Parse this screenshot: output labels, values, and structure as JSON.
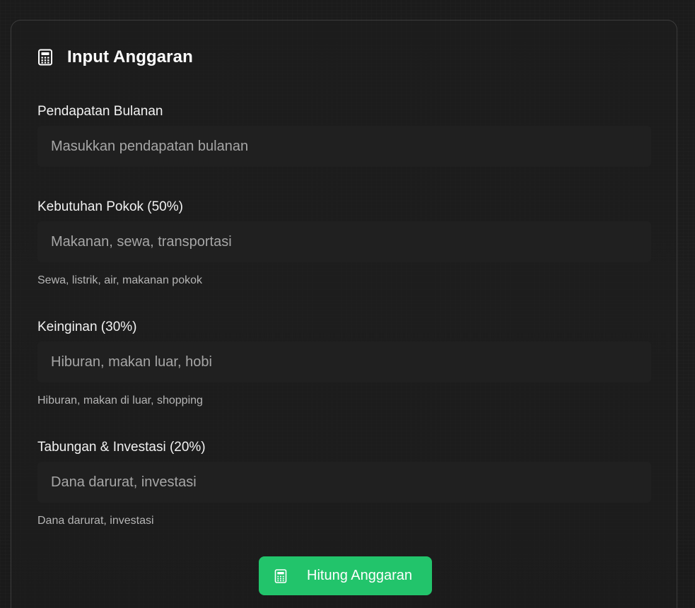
{
  "card": {
    "icon": "calculator-icon",
    "title": "Input Anggaran"
  },
  "fields": [
    {
      "label": "Pendapatan Bulanan",
      "placeholder": "Masukkan pendapatan bulanan",
      "value": "",
      "hint": ""
    },
    {
      "label": "Kebutuhan Pokok (50%)",
      "placeholder": "Makanan, sewa, transportasi",
      "value": "",
      "hint": "Sewa, listrik, air, makanan pokok"
    },
    {
      "label": "Keinginan (30%)",
      "placeholder": "Hiburan, makan luar, hobi",
      "value": "",
      "hint": "Hiburan, makan di luar, shopping"
    },
    {
      "label": "Tabungan & Investasi (20%)",
      "placeholder": "Dana darurat, investasi",
      "value": "",
      "hint": "Dana darurat, investasi"
    }
  ],
  "submit": {
    "icon": "calculator-icon",
    "label": "Hitung Anggaran"
  },
  "colors": {
    "accent": "#22c46b",
    "background": "#1a1a1a",
    "input_background": "#202020"
  }
}
